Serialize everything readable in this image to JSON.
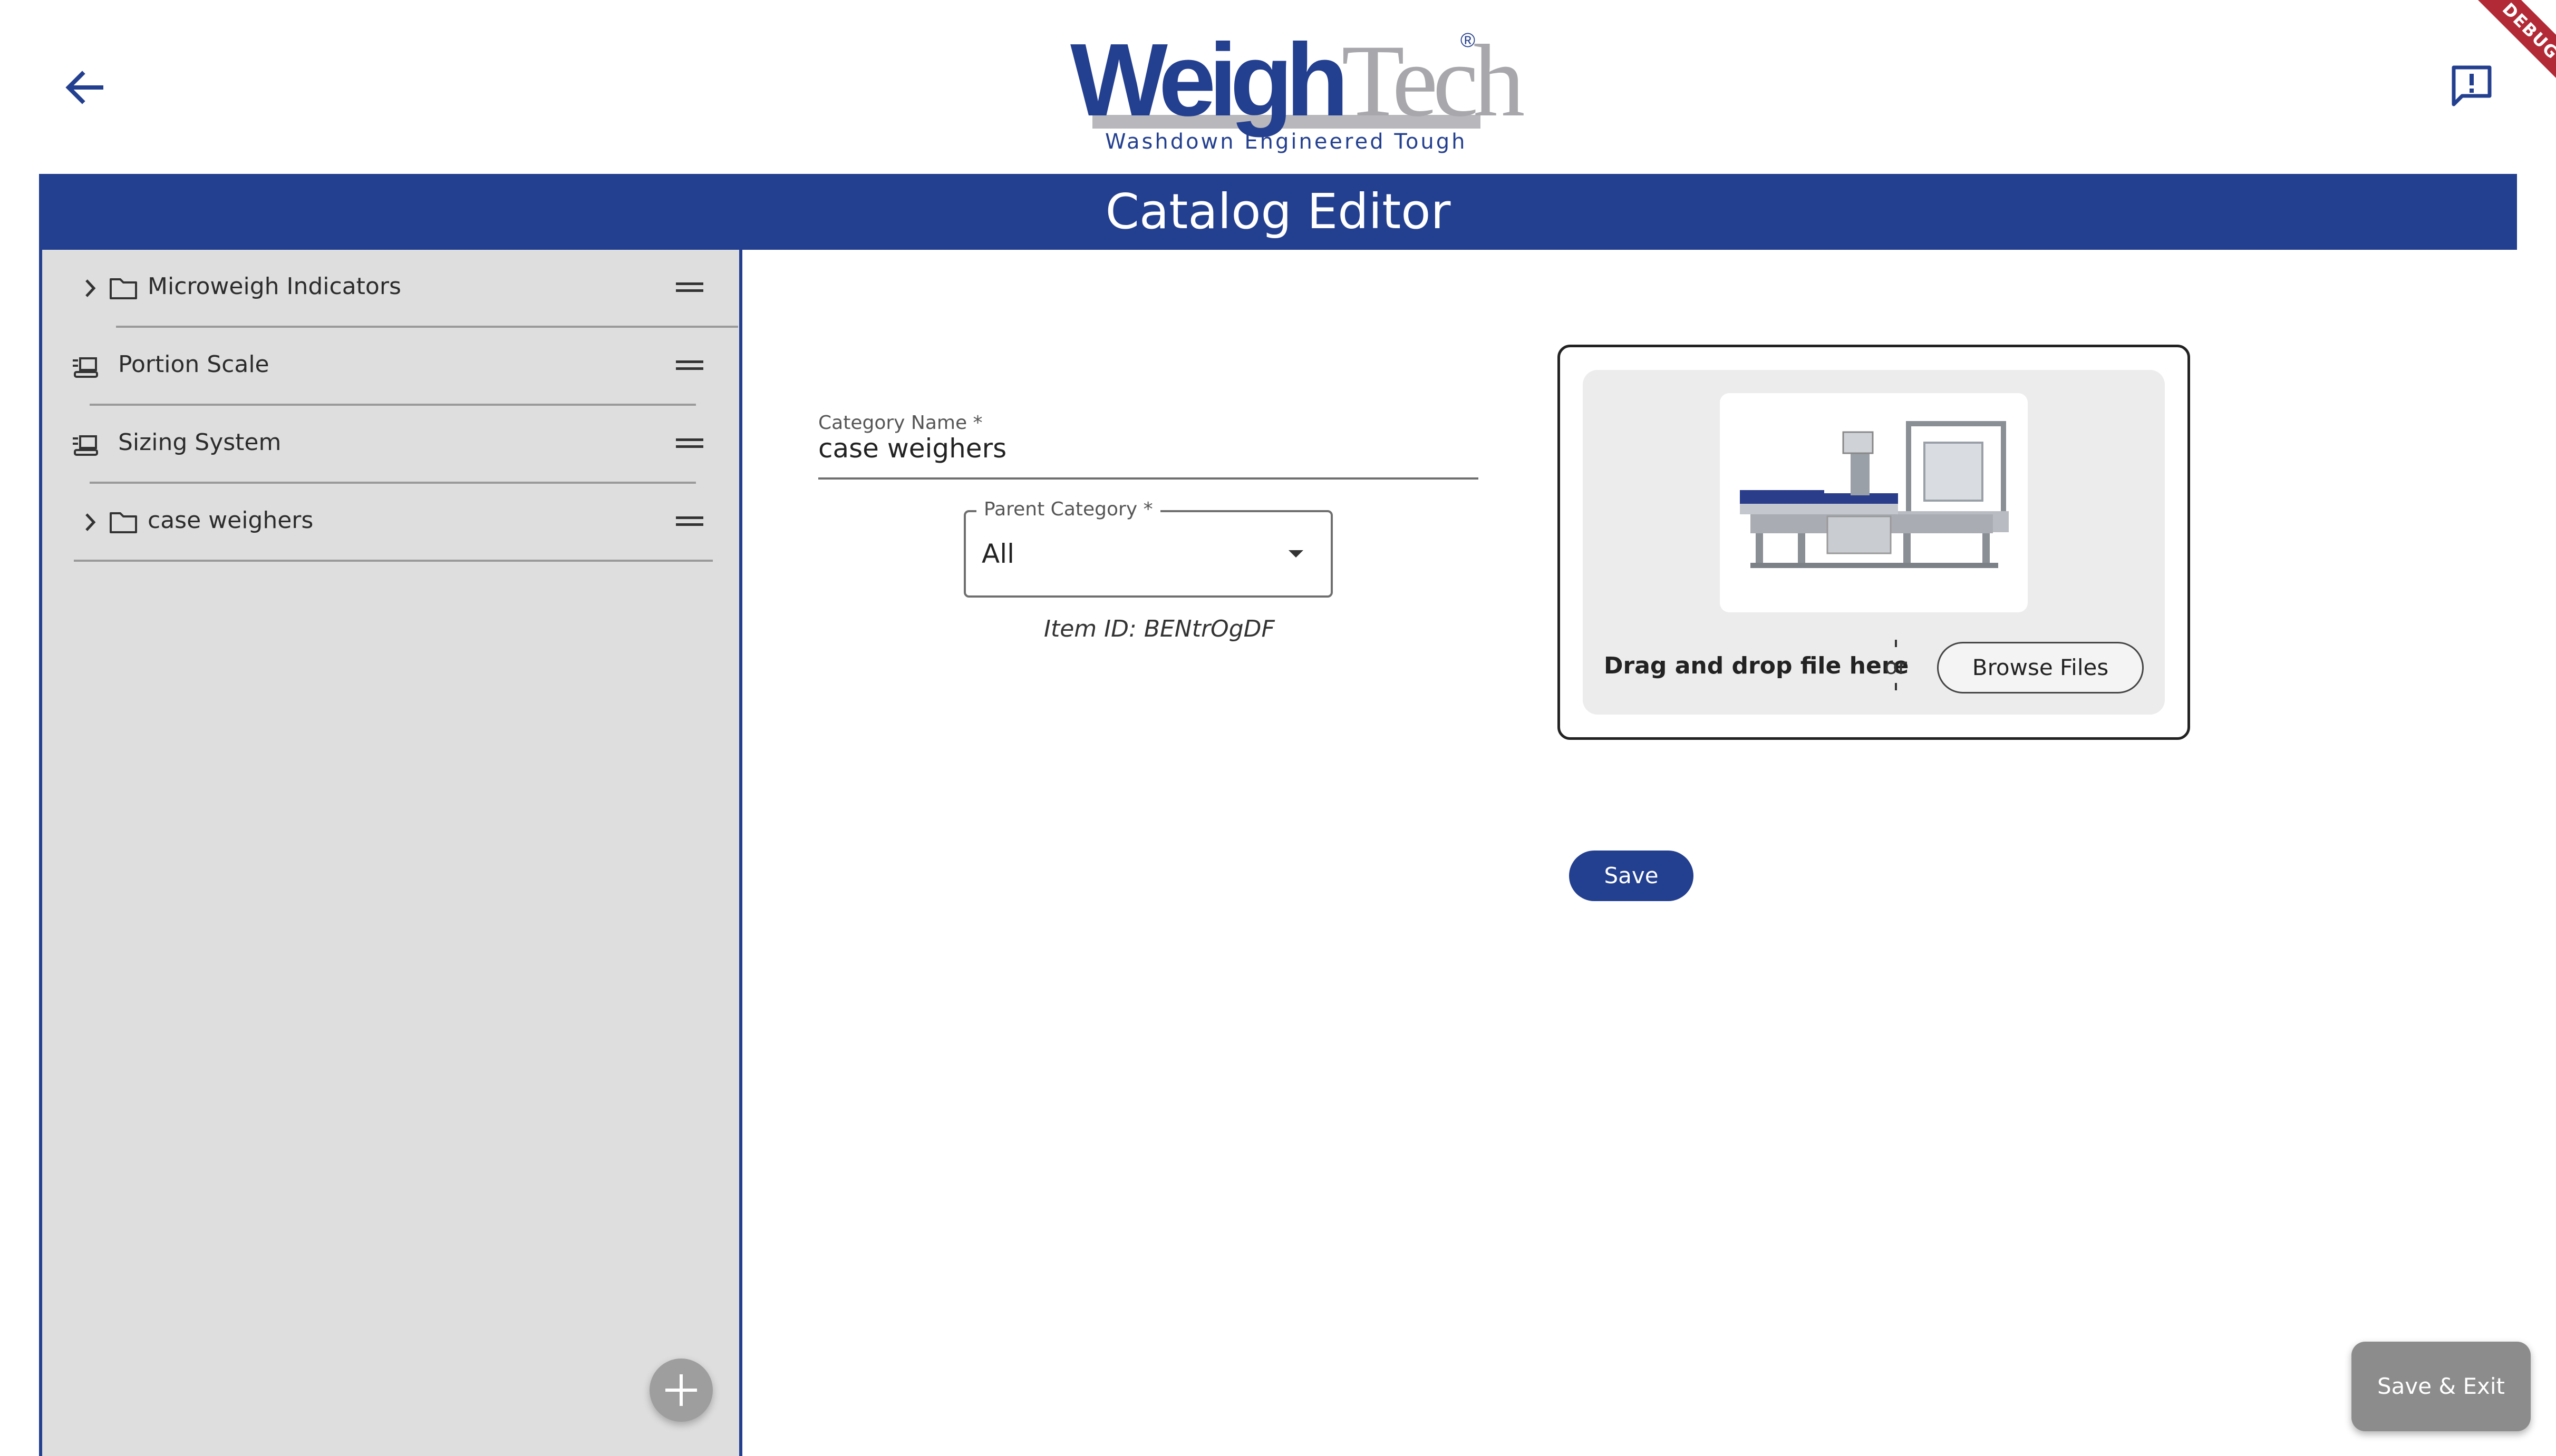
{
  "app": {
    "logo": {
      "brand_part1": "Weigh",
      "brand_part2": "Tech",
      "registered": "®",
      "tagline": "Washdown Engineered Tough"
    },
    "debug_banner": "DEBUG",
    "icons": {
      "back": "arrow-left-icon",
      "feedback": "feedback-icon"
    }
  },
  "title_bar": {
    "title": "Catalog Editor"
  },
  "sidebar": {
    "items": [
      {
        "label": "Microweigh Indicators",
        "type": "folder",
        "expandable": true,
        "icon": "folder-icon"
      },
      {
        "label": "Portion Scale",
        "type": "product",
        "expandable": false,
        "icon": "scale-icon"
      },
      {
        "label": "Sizing System",
        "type": "product",
        "expandable": false,
        "icon": "scale-icon"
      },
      {
        "label": "case weighers",
        "type": "folder",
        "expandable": true,
        "icon": "folder-icon"
      }
    ],
    "add_button_icon": "plus-icon"
  },
  "form": {
    "category_name": {
      "label": "Category Name *",
      "value": "case weighers"
    },
    "parent_category": {
      "label": "Parent Category *",
      "value": "All"
    },
    "item_id": "Item ID: BENtrOgDF"
  },
  "upload": {
    "drag_text": "Drag and drop file here",
    "or_text": "or",
    "browse_label": "Browse Files",
    "preview_icon": "case-weigher-machine-image"
  },
  "actions": {
    "save_label": "Save",
    "save_exit_label": "Save & Exit"
  },
  "colors": {
    "brand_blue": "#233f8f",
    "sidebar_bg": "#dedede",
    "debug_red": "#b22a36",
    "fab_gray": "#9e9e9e"
  }
}
